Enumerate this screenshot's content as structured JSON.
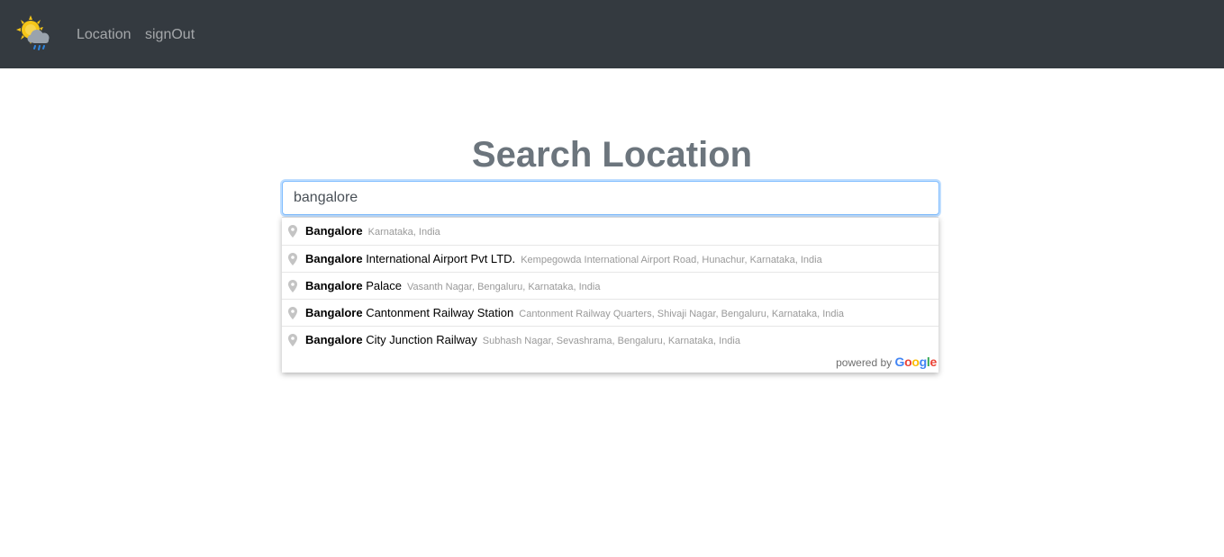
{
  "nav": {
    "logo_icon": "weather-sun-cloud-rain-icon",
    "links": [
      {
        "label": "Location"
      },
      {
        "label": "signOut"
      }
    ]
  },
  "main": {
    "title": "Search Location",
    "search": {
      "value": "bangalore"
    }
  },
  "suggestions": {
    "items": [
      {
        "matched": "Bangalore",
        "rest": "",
        "secondary": "Karnataka, India"
      },
      {
        "matched": "Bangalore",
        "rest": " International Airport Pvt LTD.",
        "secondary": "Kempegowda International Airport Road, Hunachur, Karnataka, India"
      },
      {
        "matched": "Bangalore",
        "rest": " Palace",
        "secondary": "Vasanth Nagar, Bengaluru, Karnataka, India"
      },
      {
        "matched": "Bangalore",
        "rest": " Cantonment Railway Station",
        "secondary": "Cantonment Railway Quarters, Shivaji Nagar, Bengaluru, Karnataka, India"
      },
      {
        "matched": "Bangalore",
        "rest": " City Junction Railway",
        "secondary": "Subhash Nagar, Sevashrama, Bengaluru, Karnataka, India"
      }
    ],
    "footer": {
      "powered_by": "powered by",
      "brand_letters": [
        "G",
        "o",
        "o",
        "g",
        "l",
        "e"
      ]
    }
  },
  "colors": {
    "navbar": "#343a40",
    "title": "#6c757d",
    "input_border": "#80bdff"
  }
}
